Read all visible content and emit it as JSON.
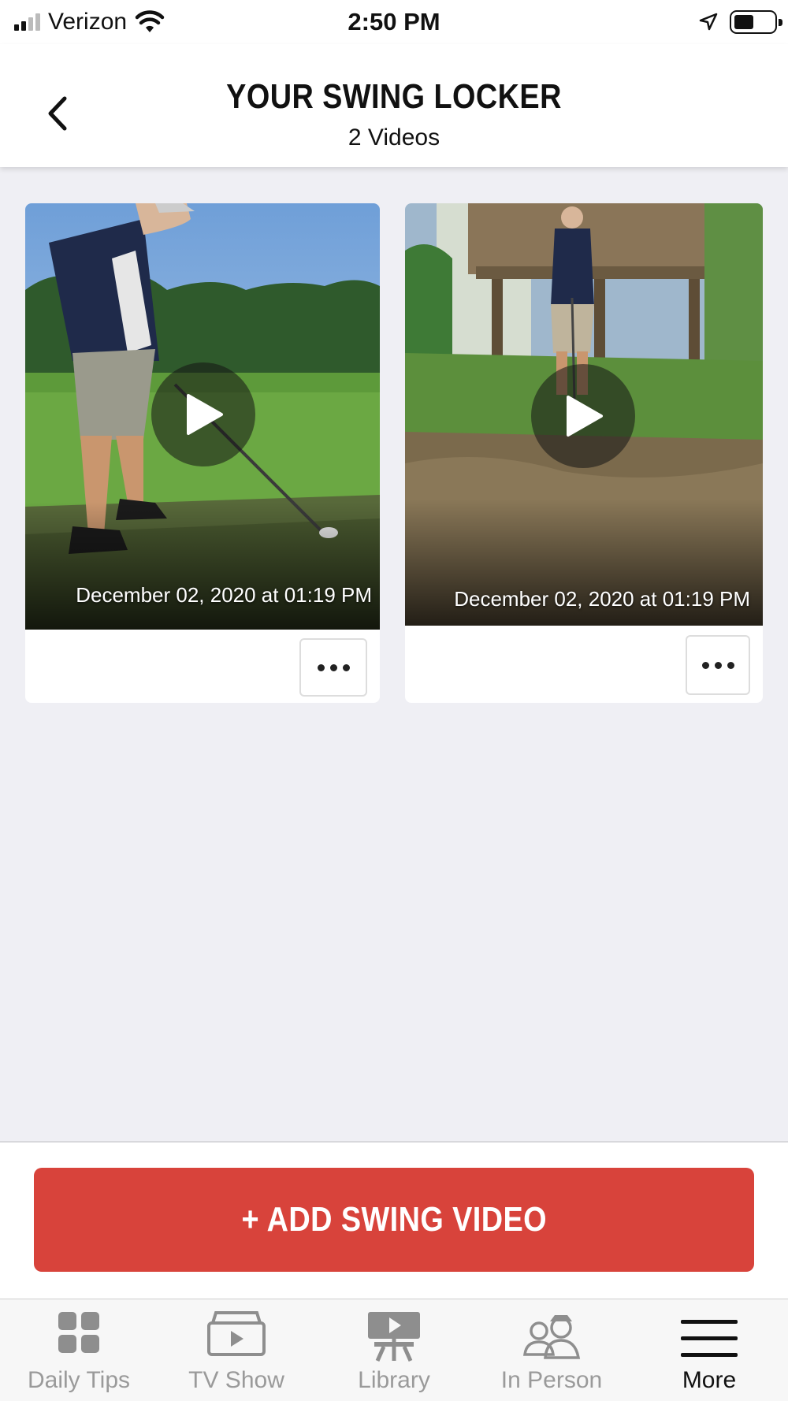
{
  "status_bar": {
    "carrier": "Verizon",
    "time": "2:50 PM"
  },
  "header": {
    "title": "YOUR SWING LOCKER",
    "subtitle": "2 Videos"
  },
  "videos": [
    {
      "date": "December 02, 2020 at 01:19 PM"
    },
    {
      "date": "December 02, 2020 at 01:19 PM"
    }
  ],
  "add_button_label": "+ ADD SWING VIDEO",
  "tabs": [
    {
      "label": "Daily Tips",
      "icon": "grid-icon",
      "active": false
    },
    {
      "label": "TV Show",
      "icon": "tv-show-icon",
      "active": false
    },
    {
      "label": "Library",
      "icon": "library-icon",
      "active": false
    },
    {
      "label": "In Person",
      "icon": "instructors-icon",
      "active": false
    },
    {
      "label": "More",
      "icon": "menu-icon",
      "active": true
    }
  ],
  "colors": {
    "accent": "#d8433b",
    "background": "#efeff4",
    "tab_inactive": "#9a9a9a",
    "tab_active": "#111111"
  }
}
